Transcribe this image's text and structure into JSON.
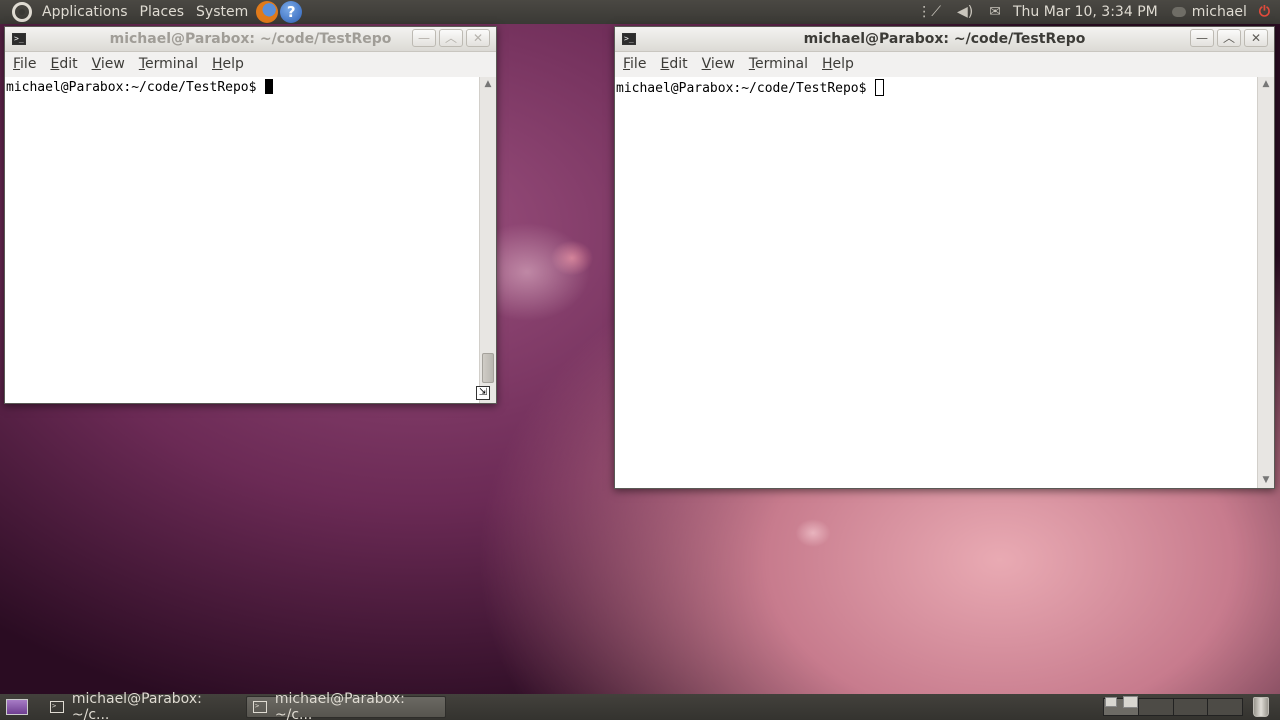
{
  "top_panel": {
    "menus": [
      "Applications",
      "Places",
      "System"
    ],
    "icons": [
      "ubuntu-logo-icon",
      "firefox-icon",
      "help-icon",
      "network-icon",
      "volume-icon",
      "mail-icon",
      "chat-status-icon",
      "power-icon"
    ],
    "help_glyph": "?",
    "clock": "Thu Mar 10,  3:34 PM",
    "user": "michael"
  },
  "windows": [
    {
      "id": "left",
      "title": "michael@Parabox: ~/code/TestRepo",
      "state": "inactive",
      "menu": [
        "File",
        "Edit",
        "View",
        "Terminal",
        "Help"
      ],
      "prompt": "michael@Parabox:~/code/TestRepo$ "
    },
    {
      "id": "right",
      "title": "michael@Parabox: ~/code/TestRepo",
      "state": "active",
      "menu": [
        "File",
        "Edit",
        "View",
        "Terminal",
        "Help"
      ],
      "prompt": "michael@Parabox:~/code/TestRepo$ "
    }
  ],
  "taskbar": {
    "tasks": [
      {
        "label": "michael@Parabox: ~/c...",
        "active": false
      },
      {
        "label": "michael@Parabox: ~/c...",
        "active": true
      }
    ],
    "workspace_count": 4,
    "current_workspace": 1
  },
  "colors": {
    "panel": "#3a3935",
    "title_active": "#3c3b37",
    "title_inactive": "#a09d97",
    "power": "#e24a3b"
  }
}
